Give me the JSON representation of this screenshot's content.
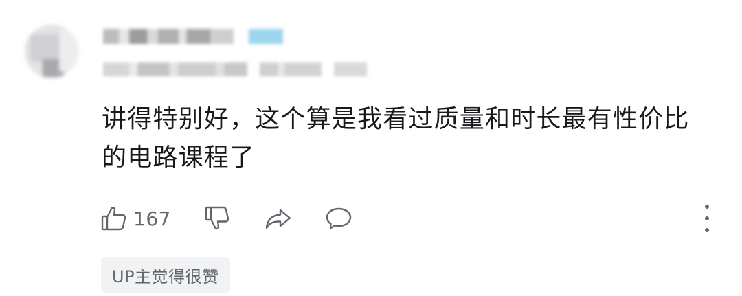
{
  "comment": {
    "text": "讲得特别好，这个算是我看过质量和时长最有性价比的电路课程了",
    "like_count": "167",
    "up_badge": "UP主觉得很赞"
  },
  "icons": {
    "like": "thumbs-up-icon",
    "dislike": "thumbs-down-icon",
    "share": "share-arrow-icon",
    "reply": "speech-bubble-icon",
    "more": "vertical-ellipsis-icon"
  },
  "colors": {
    "text": "#18191c",
    "secondary": "#61666d",
    "badge_bg": "#f1f2f3",
    "level_badge": "#9fd6ee"
  }
}
